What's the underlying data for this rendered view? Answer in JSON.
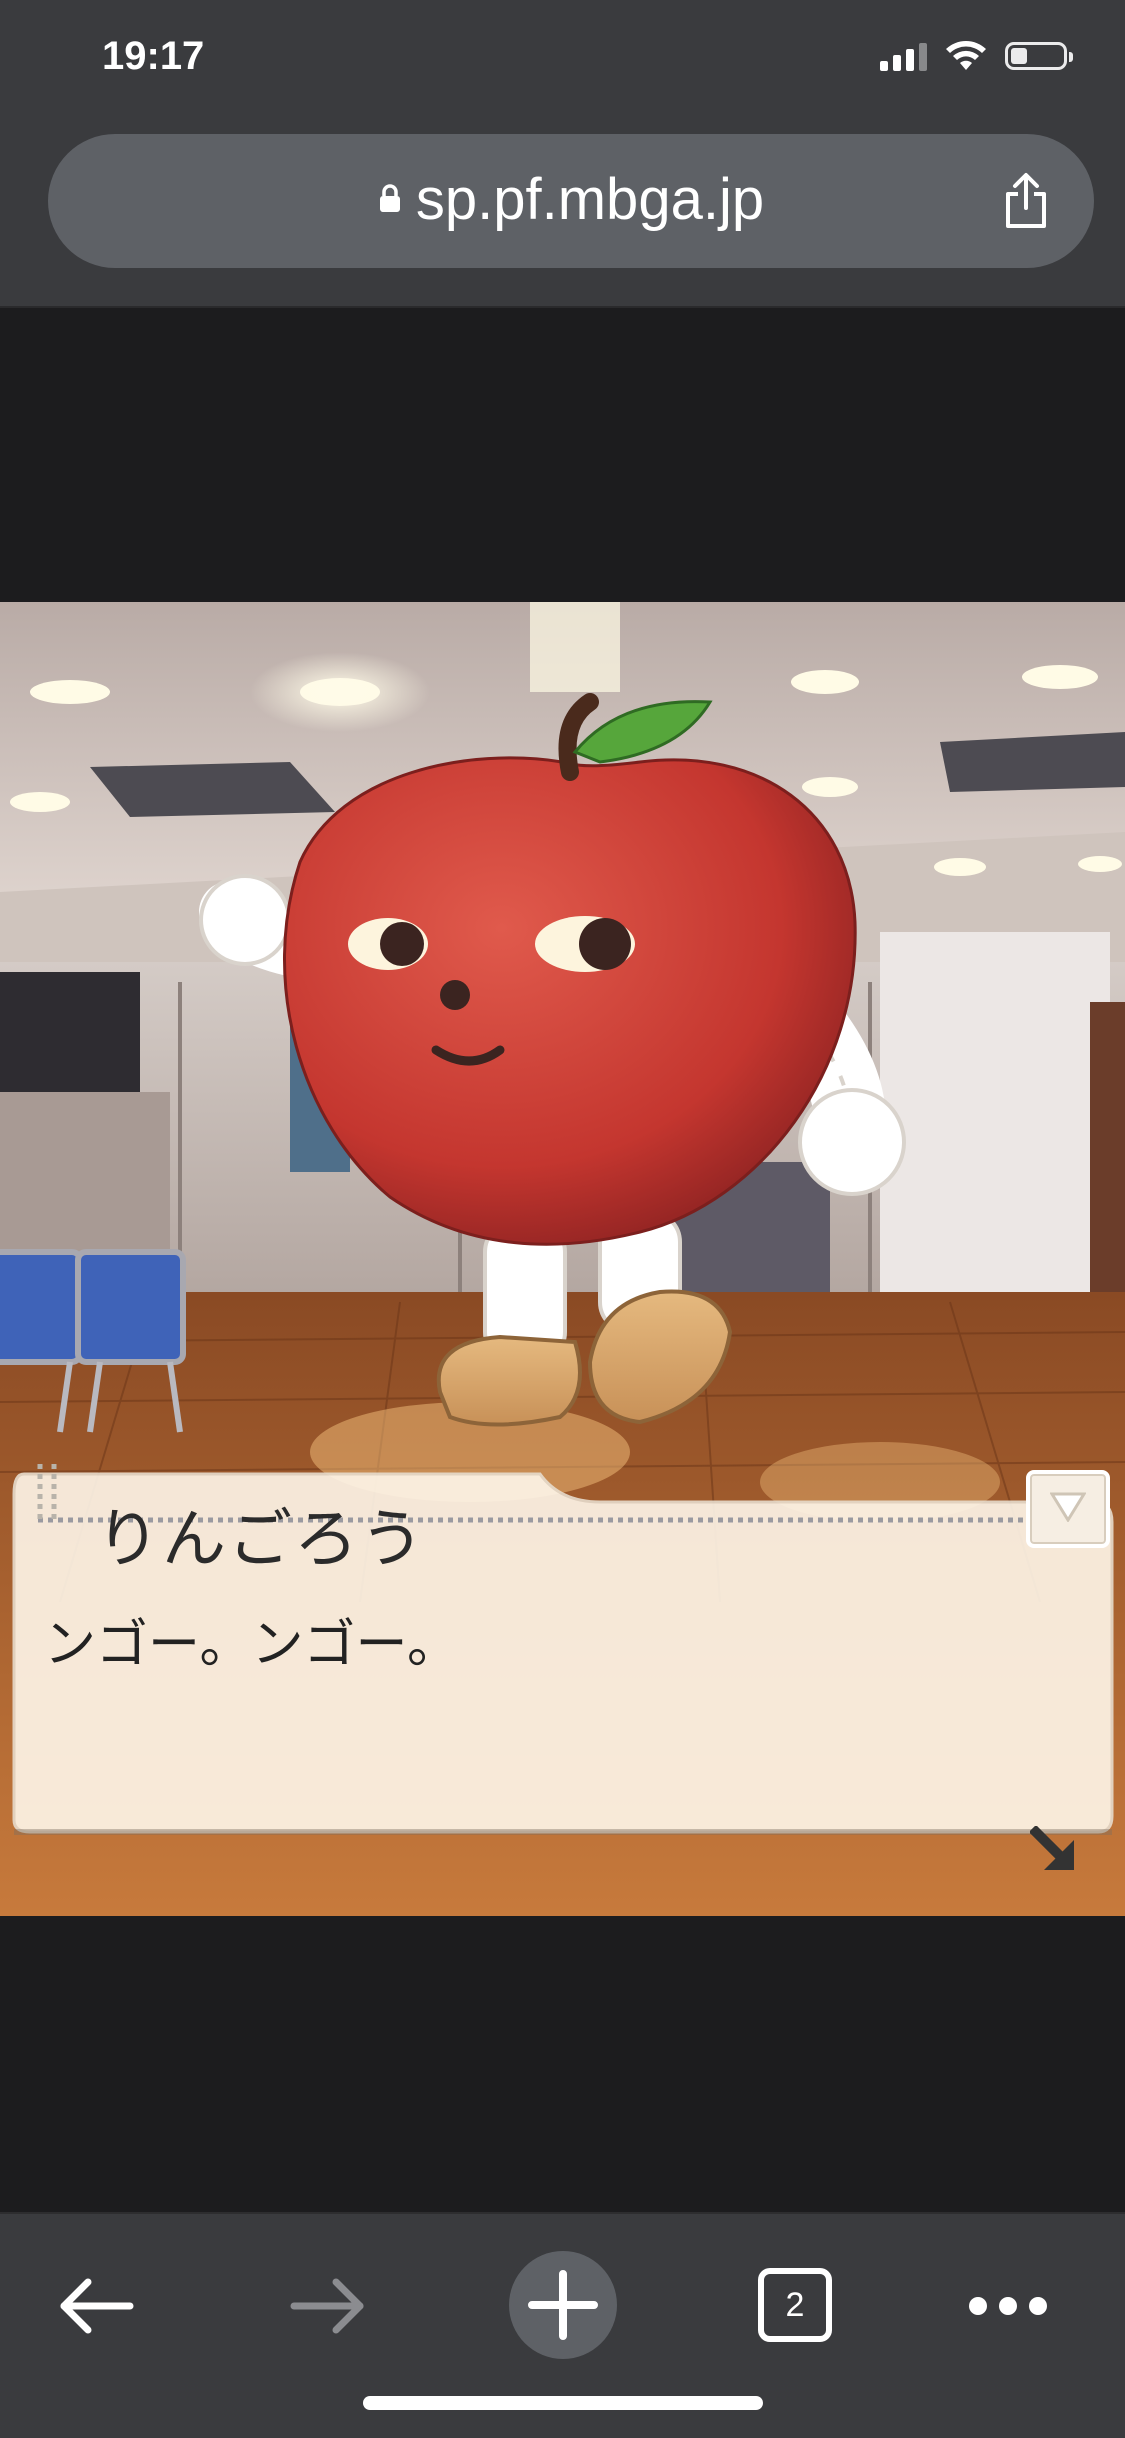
{
  "status_bar": {
    "time": "19:17"
  },
  "browser": {
    "url": "sp.pf.mbga.jp",
    "tab_count": "2"
  },
  "dialogue": {
    "speaker": "りんごろう",
    "message": "ンゴー。ンゴー。"
  },
  "icons": {
    "lock": "lock-icon",
    "share": "share-icon",
    "back": "back-arrow-icon",
    "forward": "forward-arrow-icon",
    "new_tab": "plus-icon",
    "tabs": "tabs-icon",
    "more": "more-icon",
    "auto": "triangle-down-icon",
    "next": "next-arrow-icon"
  },
  "colors": {
    "browser_chrome": "#3a3b3e",
    "url_field": "#5e6166",
    "page_background": "#1c1c1e",
    "apple_red": "#c83a33"
  }
}
